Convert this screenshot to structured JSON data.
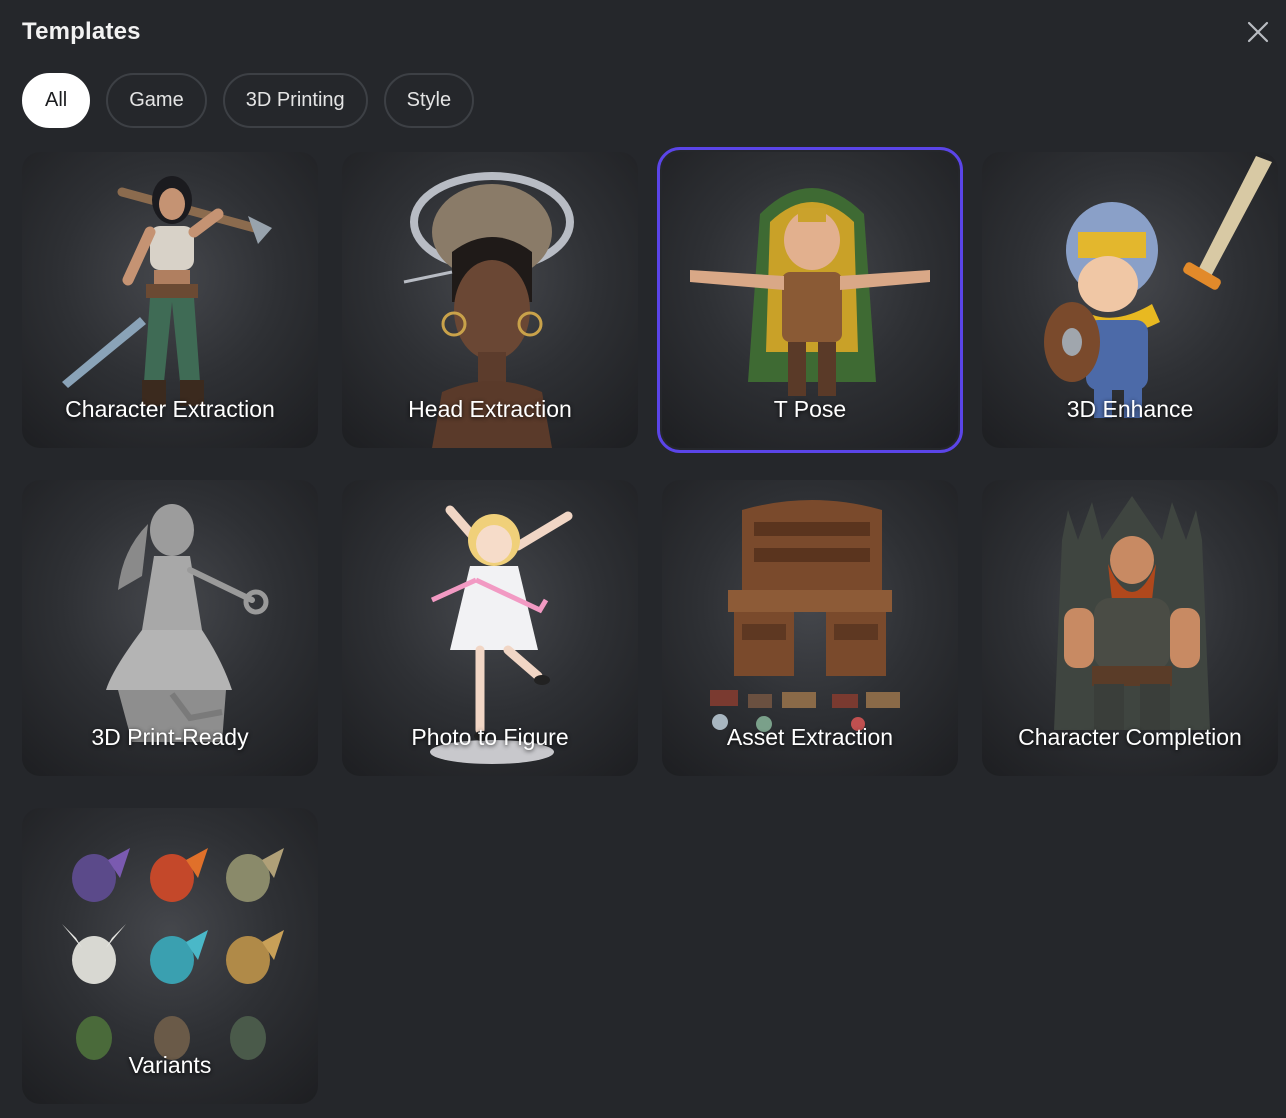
{
  "header": {
    "title": "Templates"
  },
  "tabs": [
    {
      "label": "All",
      "active": true
    },
    {
      "label": "Game",
      "active": false
    },
    {
      "label": "3D Printing",
      "active": false
    },
    {
      "label": "Style",
      "active": false
    }
  ],
  "templates": [
    {
      "label": "Character Extraction",
      "icon": "warrior-woman-icon",
      "selected": false
    },
    {
      "label": "Head Extraction",
      "icon": "head-bust-icon",
      "selected": false
    },
    {
      "label": "T Pose",
      "icon": "hooded-character-tpose-icon",
      "selected": true
    },
    {
      "label": "3D Enhance",
      "icon": "knight-sword-icon",
      "selected": false
    },
    {
      "label": "3D Print-Ready",
      "icon": "gray-figurine-icon",
      "selected": false
    },
    {
      "label": "Photo to Figure",
      "icon": "anime-girl-figure-icon",
      "selected": false
    },
    {
      "label": "Asset Extraction",
      "icon": "wooden-desk-icon",
      "selected": false
    },
    {
      "label": "Character Completion",
      "icon": "dwarf-on-throne-icon",
      "selected": false
    },
    {
      "label": "Variants",
      "icon": "dragon-grid-icon",
      "selected": false
    }
  ],
  "colors": {
    "accent": "#5b45e8",
    "background": "#25272b",
    "card": "#2e3034"
  }
}
